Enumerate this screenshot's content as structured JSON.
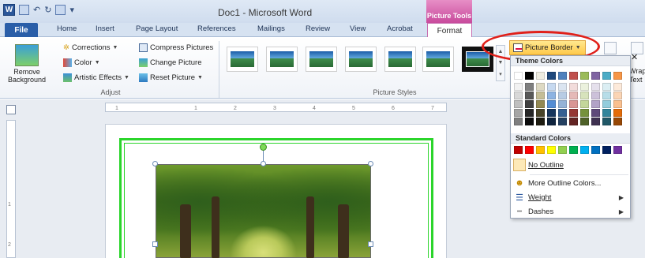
{
  "window": {
    "title": "Doc1 - Microsoft Word",
    "context_tab_group": "Picture Tools",
    "app_icon": "W"
  },
  "tabs": [
    "File",
    "Home",
    "Insert",
    "Page Layout",
    "References",
    "Mailings",
    "Review",
    "View",
    "Acrobat",
    "Format"
  ],
  "ribbon": {
    "remove_background": "Remove Background",
    "adjust": {
      "label": "Adjust",
      "corrections": "Corrections",
      "color": "Color",
      "artistic_effects": "Artistic Effects",
      "compress_pictures": "Compress Pictures",
      "change_picture": "Change Picture",
      "reset_picture": "Reset Picture"
    },
    "picture_styles": {
      "label": "Picture Styles",
      "thumb_count": 7,
      "selected_index": 6
    },
    "picture_border": "Picture Border",
    "wrap_text": "Wrap Text"
  },
  "ruler": {
    "h_marks": [
      "1",
      "1",
      "2",
      "3",
      "4",
      "5",
      "6",
      "7"
    ],
    "v_marks": [
      "1",
      "2"
    ]
  },
  "dropdown": {
    "theme_colors_label": "Theme Colors",
    "theme_top_row": [
      "#ffffff",
      "#000000",
      "#eeece1",
      "#1f497d",
      "#4f81bd",
      "#c0504d",
      "#9bbb59",
      "#8064a2",
      "#4bacc6",
      "#f79646"
    ],
    "theme_shades": [
      [
        "#f2f2f2",
        "#7f7f7f",
        "#ddd9c3",
        "#c6d9f0",
        "#dbe5f1",
        "#f2dcdb",
        "#ebf1dd",
        "#e5e0ec",
        "#dbeef3",
        "#fdeada"
      ],
      [
        "#d8d8d8",
        "#595959",
        "#c4bd97",
        "#8db3e2",
        "#b8cce4",
        "#e5b9b7",
        "#d7e3bc",
        "#ccc1d9",
        "#b7dde8",
        "#fbd5b5"
      ],
      [
        "#bfbfbf",
        "#3f3f3f",
        "#938953",
        "#548dd4",
        "#95b3d7",
        "#d99694",
        "#c3d69b",
        "#b2a2c7",
        "#92cddc",
        "#fac08f"
      ],
      [
        "#a5a5a5",
        "#262626",
        "#494429",
        "#17365d",
        "#366092",
        "#953734",
        "#76923c",
        "#5f497a",
        "#31859b",
        "#e36c09"
      ],
      [
        "#7f7f7f",
        "#0c0c0c",
        "#1d1b10",
        "#0f243e",
        "#244061",
        "#632423",
        "#4f6128",
        "#3f3151",
        "#205867",
        "#974806"
      ]
    ],
    "standard_colors_label": "Standard Colors",
    "standard_colors": [
      "#c00000",
      "#ff0000",
      "#ffc000",
      "#ffff00",
      "#92d050",
      "#00b050",
      "#00b0f0",
      "#0070c0",
      "#002060",
      "#7030a0"
    ],
    "no_outline": "No Outline",
    "more_outline_colors": "More Outline Colors...",
    "weight": "Weight",
    "dashes": "Dashes"
  },
  "colors": {
    "highlight_oval": "#e0201a",
    "picture_border": "#2bd52b",
    "file_tab": "#2a5ea8",
    "context_tab": "#c84a9c"
  }
}
